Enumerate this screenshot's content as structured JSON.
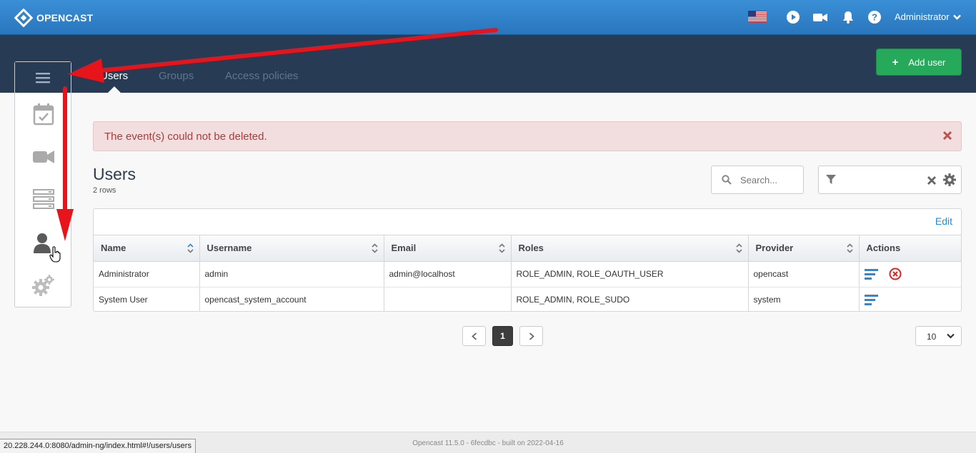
{
  "header": {
    "brand": "OPENCAST",
    "user": "Administrator",
    "icons": [
      "us-flag-icon",
      "play-icon",
      "video-camera-icon",
      "bell-icon",
      "help-icon"
    ]
  },
  "tabs": [
    {
      "label": "Users",
      "active": true
    },
    {
      "label": "Groups",
      "active": false
    },
    {
      "label": "Access policies",
      "active": false
    }
  ],
  "add_user": {
    "label": "Add user"
  },
  "sidemenu": {
    "icons": [
      "menu-icon",
      "calendar-icon",
      "video-camera-icon",
      "servers-icon",
      "users-icon",
      "gears-icon"
    ]
  },
  "alert": {
    "message": "The event(s) could not be deleted."
  },
  "page": {
    "title": "Users",
    "count": "2 rows"
  },
  "search": {
    "placeholder": "Search..."
  },
  "table": {
    "edit_label": "Edit",
    "columns": [
      "Name",
      "Username",
      "Email",
      "Roles",
      "Provider",
      "Actions"
    ],
    "rows": [
      {
        "name": "Administrator",
        "username": "admin",
        "email": "admin@localhost",
        "roles": "ROLE_ADMIN, ROLE_OAUTH_USER",
        "provider": "opencast"
      },
      {
        "name": "System User",
        "username": "opencast_system_account",
        "email": "",
        "roles": "ROLE_ADMIN, ROLE_SUDO",
        "provider": "system"
      }
    ]
  },
  "pagination": {
    "current": "1",
    "page_size": "10"
  },
  "footer": {
    "version": "Opencast 11.5.0 - 6fecdbc - built on 2022-04-16"
  },
  "status_url": "20.228.244.0:8080/admin-ng/index.html#!/users/users",
  "colors": {
    "header": "#2f82ca",
    "subnav": "#273c54",
    "add_button": "#26a95b",
    "alert_bg": "#f2dede",
    "annotation_arrow": "#e8141b"
  }
}
